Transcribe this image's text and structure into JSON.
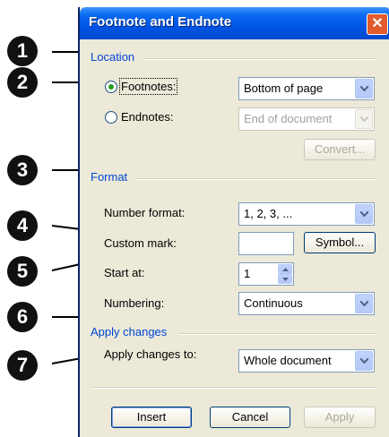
{
  "callouts": [
    "1",
    "2",
    "3",
    "4",
    "5",
    "6",
    "7"
  ],
  "dialog": {
    "title": "Footnote and Endnote",
    "close_symbol": "✕",
    "location": {
      "group_label": "Location",
      "footnotes": {
        "label": "Footnotes:",
        "selected": true,
        "position": "Bottom of page"
      },
      "endnotes": {
        "label": "Endnotes:",
        "selected": false,
        "position": "End of document"
      },
      "convert_label": "Convert..."
    },
    "format": {
      "group_label": "Format",
      "number_format_label": "Number format:",
      "number_format_value": "1, 2, 3, ...",
      "custom_mark_label": "Custom mark:",
      "custom_mark_value": "",
      "symbol_label": "Symbol...",
      "start_at_label": "Start at:",
      "start_at_value": "1",
      "numbering_label": "Numbering:",
      "numbering_value": "Continuous"
    },
    "apply": {
      "group_label": "Apply changes",
      "apply_to_label": "Apply changes to:",
      "apply_to_value": "Whole document"
    },
    "buttons": {
      "insert": "Insert",
      "cancel": "Cancel",
      "apply": "Apply"
    }
  }
}
